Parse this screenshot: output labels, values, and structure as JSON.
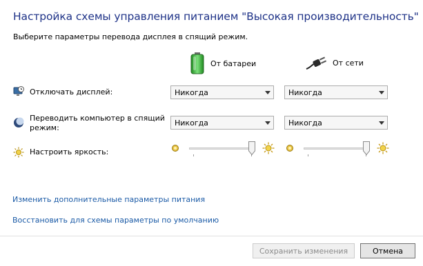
{
  "header": {
    "title": "Настройка схемы управления питанием \"Высокая производительность\"",
    "subtitle": "Выберите параметры перевода дисплея в спящий режим."
  },
  "columns": {
    "battery": "От батареи",
    "ac": "От сети"
  },
  "rows": {
    "display_off": {
      "label": "Отключать дисплей:",
      "icon": "monitor-clock-icon",
      "battery_value": "Никогда",
      "ac_value": "Никогда"
    },
    "sleep": {
      "label_line1": "Переводить компьютер в спящий",
      "label_line2": "режим:",
      "icon": "moon-sleep-icon",
      "battery_value": "Никогда",
      "ac_value": "Никогда"
    },
    "brightness": {
      "label": "Настроить яркость:",
      "icon": "sun-brightness-icon",
      "battery_level": 1.0,
      "ac_level": 1.0
    }
  },
  "links": {
    "advanced": "Изменить дополнительные параметры питания",
    "restore": "Восстановить для схемы параметры по умолчанию"
  },
  "buttons": {
    "save": "Сохранить изменения",
    "cancel": "Отмена"
  },
  "colors": {
    "title": "#1e3287",
    "link": "#1a5aa6",
    "battery_green": "#3cb43c"
  }
}
